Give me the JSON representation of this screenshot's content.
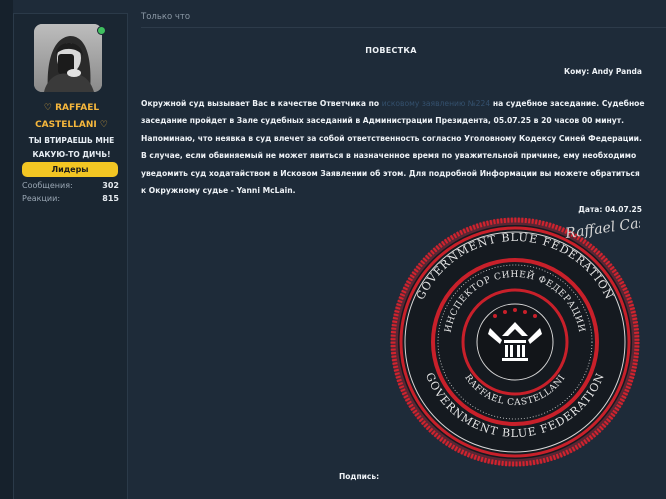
{
  "user": {
    "name": "♡ RAFFAEL CASTELLANI ♡",
    "title": "ТЫ ВТИРАЕШЬ МНЕ КАКУЮ-ТО ДИЧЬ!",
    "badge": "Лидеры",
    "stats": [
      {
        "label": "Сообщения:",
        "value": "302"
      },
      {
        "label": "Реакции:",
        "value": "815"
      }
    ],
    "status_color": "#3fbf5f"
  },
  "post": {
    "timestamp": "Только что",
    "doc_title": "ПОВЕСТКА",
    "to_line": "Кому: Andy Panda",
    "body_before_link": "Окружной суд вызывает Вас в качестве Ответчика по ",
    "body_link": "исковому заявлению №224",
    "body_after_link": " на судебное заседание. Судебное заседание пройдет в Зале судебных заседаний в Администрации Президента, 05.07.25 в 20 часов 00 минут. Напоминаю, что неявка в суд влечет за собой ответственность согласно Уголовному Кодексу Синей Федерации. В случае, если обвиняемый не может явиться в назначенное время по уважительной причине, ему необходимо уведомить суд ходатайством в Исковом Заявлении об этом. Для подробной Информации вы можете обратиться к Окружному судье - Yanni McLain.",
    "date_line": "Дата: 04.07.25",
    "signature_label": "Подпись:"
  },
  "seal": {
    "outer_text": "GOVERNMENT BLUE FEDERATION",
    "inner_text": "ИНСПЕКТОР СИНЕЙ ФЕДЕРАЦИИ",
    "bottom_text": "RAFFAEL CASTELLANI",
    "signature_text": "Raffael Castellani",
    "accent_color": "#c8202a"
  }
}
